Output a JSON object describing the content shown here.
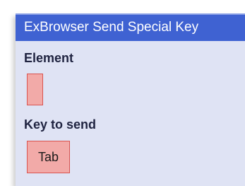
{
  "node": {
    "title": "ExBrowser Send Special Key",
    "fields": [
      {
        "label": "Element",
        "value": ""
      },
      {
        "label": "Key to send",
        "value": "Tab"
      }
    ]
  },
  "colors": {
    "header_bg": "#3f62d2",
    "body_bg": "#dfe3f4",
    "value_bg": "#f2aaa8",
    "value_border": "#d9534f"
  }
}
